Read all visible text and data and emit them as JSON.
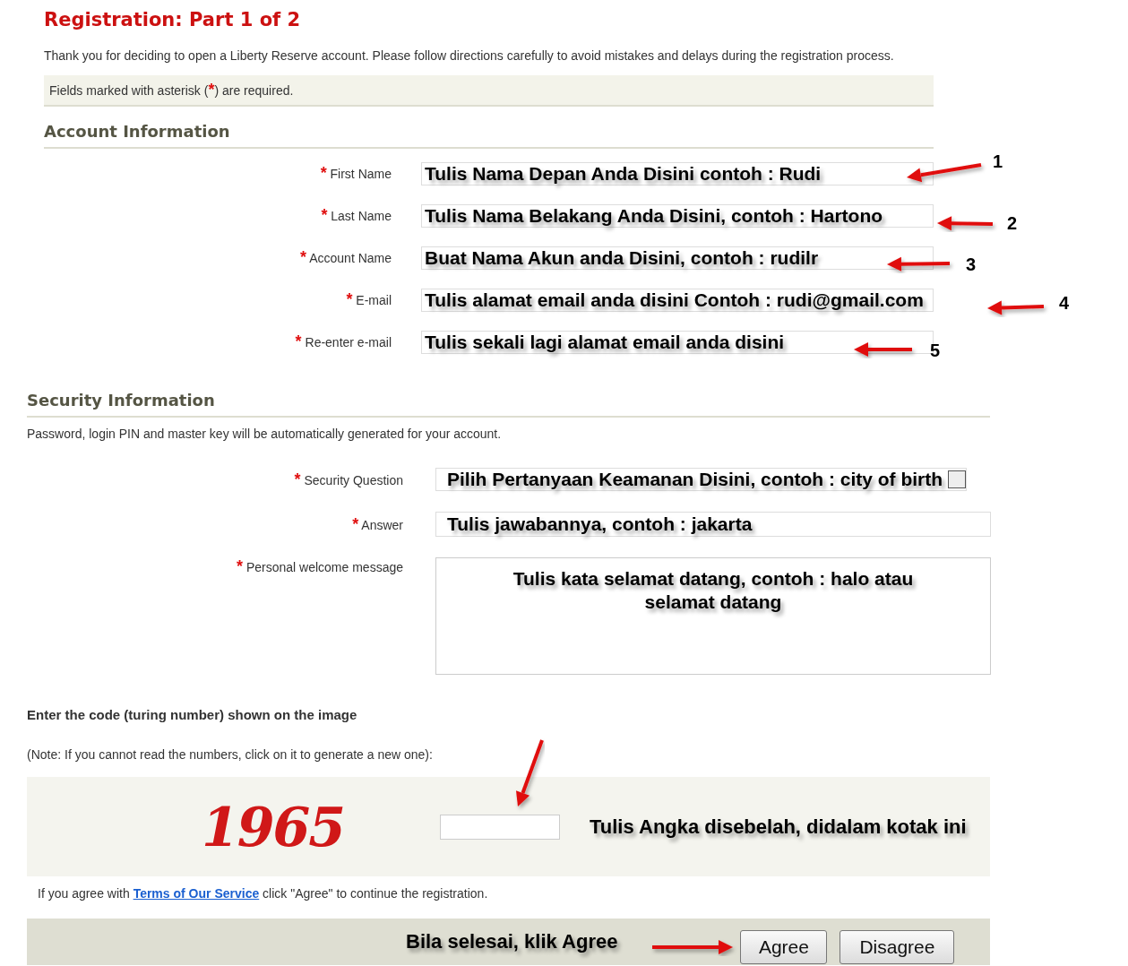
{
  "title": "Registration: Part 1 of 2",
  "intro": "Thank you for deciding to open a Liberty Reserve account. Please follow directions carefully to avoid mistakes and delays during the registration process.",
  "required_note": {
    "before": "Fields marked with asterisk (",
    "asterisk": "*",
    "after": ") are required."
  },
  "account_section": {
    "heading": "Account Information",
    "fields": [
      {
        "asterisk": "*",
        "label": "First Name",
        "annotation": "Tulis Nama Depan Anda Disini contoh : Rudi",
        "callout": "1"
      },
      {
        "asterisk": "*",
        "label": "Last Name",
        "annotation": "Tulis Nama Belakang Anda Disini, contoh : Hartono",
        "callout": "2"
      },
      {
        "asterisk": "*",
        "label": "Account Name",
        "annotation": "Buat Nama Akun anda Disini, contoh : rudilr",
        "callout": "3"
      },
      {
        "asterisk": "*",
        "label": "E-mail",
        "annotation": "Tulis alamat email anda disini Contoh : rudi@gmail.com",
        "callout": "4"
      },
      {
        "asterisk": "*",
        "label": "Re-enter e-mail",
        "annotation": "Tulis sekali lagi alamat email anda disini",
        "callout": "5"
      }
    ]
  },
  "security_section": {
    "heading": "Security Information",
    "text": "Password, login PIN and master key will be automatically generated for your account.",
    "fields": [
      {
        "kind": "select",
        "asterisk": "*",
        "label": "Security Question",
        "annotation": "Pilih Pertanyaan Keamanan Disini, contoh : city of birth"
      },
      {
        "kind": "text",
        "asterisk": "*",
        "label": "Answer",
        "annotation": "Tulis jawabannya, contoh : jakarta"
      },
      {
        "kind": "textarea",
        "asterisk": "*",
        "label": "Personal welcome message",
        "annotation": "Tulis kata selamat datang, contoh : halo atau selamat datang"
      }
    ]
  },
  "captcha_section": {
    "heading": "Enter the code (turing number) shown on the image",
    "note": "(Note: If you cannot read the numbers, click on it to generate a new one):",
    "code": "1965",
    "annotation": "Tulis Angka disebelah, didalam kotak ini"
  },
  "terms": {
    "before": "If you agree with ",
    "link": "Terms of Our Service",
    "after": " click \"Agree\" to continue the registration."
  },
  "action_bar": {
    "annotation": "Bila selesai, klik Agree",
    "buttons": [
      "Agree",
      "Disagree"
    ]
  }
}
